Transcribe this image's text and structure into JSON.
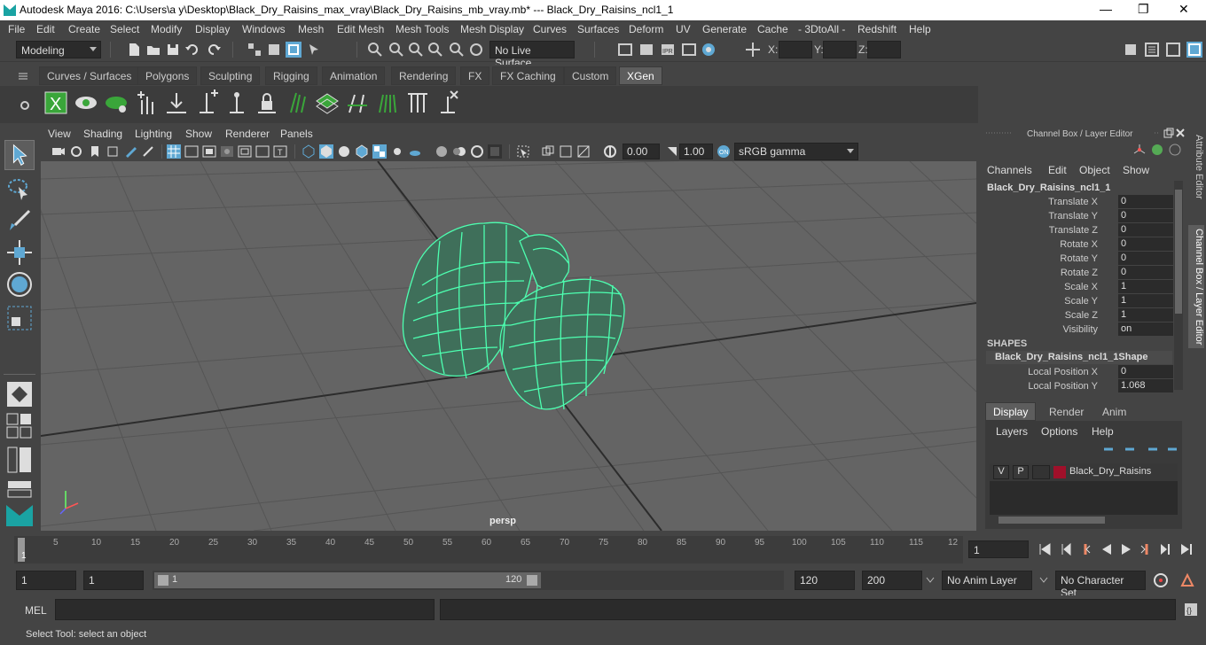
{
  "window": {
    "title": "Autodesk Maya 2016: C:\\Users\\a y\\Desktop\\Black_Dry_Raisins_max_vray\\Black_Dry_Raisins_mb_vray.mb*   ---   Black_Dry_Raisins_ncl1_1",
    "minimize": "—",
    "maximize": "❐",
    "close": "✕"
  },
  "menu": [
    "File",
    "Edit",
    "Create",
    "Select",
    "Modify",
    "Display",
    "Windows",
    "Mesh",
    "Edit Mesh",
    "Mesh Tools",
    "Mesh Display",
    "Curves",
    "Surfaces",
    "Deform",
    "UV",
    "Generate",
    "Cache",
    "- 3DtoAll -",
    "Redshift",
    "Help"
  ],
  "statusline": {
    "mode": "Modeling",
    "live_surface": "No Live Surface",
    "x_label": "X:",
    "y_label": "Y:",
    "z_label": "Z:"
  },
  "shelf_tabs": [
    "Curves / Surfaces",
    "Polygons",
    "Sculpting",
    "Rigging",
    "Animation",
    "Rendering",
    "FX",
    "FX Caching",
    "Custom",
    "XGen"
  ],
  "active_shelf": "XGen",
  "viewport": {
    "menu": [
      "View",
      "Shading",
      "Lighting",
      "Show",
      "Renderer",
      "Panels"
    ],
    "exposure": "0.00",
    "gamma": "1.00",
    "color_space": "sRGB gamma",
    "camera_label": "persp"
  },
  "channel_box": {
    "header": "Channel Box / Layer Editor",
    "menu": [
      "Channels",
      "Edit",
      "Object",
      "Show"
    ],
    "object_name": "Black_Dry_Raisins_ncl1_1",
    "attributes": [
      {
        "label": "Translate X",
        "value": "0"
      },
      {
        "label": "Translate Y",
        "value": "0"
      },
      {
        "label": "Translate Z",
        "value": "0"
      },
      {
        "label": "Rotate X",
        "value": "0"
      },
      {
        "label": "Rotate Y",
        "value": "0"
      },
      {
        "label": "Rotate Z",
        "value": "0"
      },
      {
        "label": "Scale X",
        "value": "1"
      },
      {
        "label": "Scale Y",
        "value": "1"
      },
      {
        "label": "Scale Z",
        "value": "1"
      },
      {
        "label": "Visibility",
        "value": "on"
      }
    ],
    "shapes_header": "SHAPES",
    "shape_name": "Black_Dry_Raisins_ncl1_1Shape",
    "shape_attributes": [
      {
        "label": "Local Position X",
        "value": "0"
      },
      {
        "label": "Local Position Y",
        "value": "1.068"
      }
    ]
  },
  "layer_editor": {
    "tabs": [
      "Display",
      "Render",
      "Anim"
    ],
    "active_tab": "Display",
    "menu": [
      "Layers",
      "Options",
      "Help"
    ],
    "layer": {
      "v": "V",
      "p": "P",
      "name": "Black_Dry_Raisins",
      "color": "#a0102a"
    }
  },
  "side_tabs": [
    "Attribute Editor",
    "Channel Box / Layer Editor"
  ],
  "timeline": {
    "ticks": [
      "1",
      "5",
      "10",
      "15",
      "20",
      "25",
      "30",
      "35",
      "40",
      "45",
      "50",
      "55",
      "60",
      "65",
      "70",
      "75",
      "80",
      "85",
      "90",
      "95",
      "100",
      "105",
      "110",
      "115",
      "12"
    ],
    "current_frame": "1"
  },
  "range": {
    "start": "1",
    "playback_start": "1",
    "slider_start": "1",
    "slider_end": "120",
    "playback_end": "120",
    "end": "200",
    "anim_layer": "No Anim Layer",
    "character_set": "No Character Set"
  },
  "cmdline": {
    "label": "MEL"
  },
  "help_line": "Select Tool: select an object",
  "colors": {
    "wireframe": "#4dffb0",
    "accent": "#5fa8d3",
    "xgen_green": "#3aa63a"
  }
}
